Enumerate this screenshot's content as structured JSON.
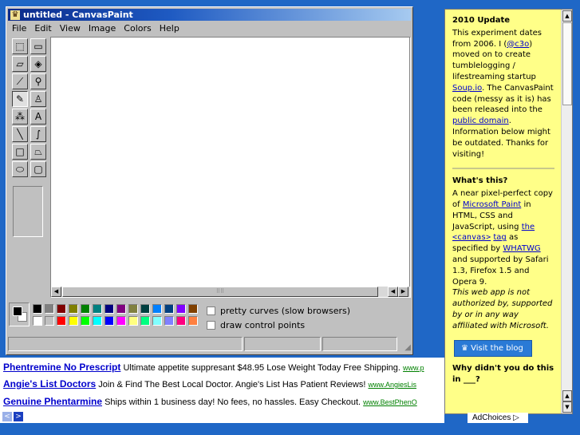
{
  "window": {
    "title": "untitled - CanvasPaint",
    "menu": [
      "File",
      "Edit",
      "View",
      "Image",
      "Colors",
      "Help"
    ]
  },
  "tools": [
    {
      "name": "free-select-icon",
      "glyph": "⬚"
    },
    {
      "name": "rect-select-icon",
      "glyph": "▭"
    },
    {
      "name": "eraser-icon",
      "glyph": "▱"
    },
    {
      "name": "fill-bucket-icon",
      "glyph": "◈"
    },
    {
      "name": "color-picker-icon",
      "glyph": "⟋"
    },
    {
      "name": "magnifier-icon",
      "glyph": "⚲"
    },
    {
      "name": "pencil-icon",
      "glyph": "✎"
    },
    {
      "name": "brush-icon",
      "glyph": "♙"
    },
    {
      "name": "airbrush-icon",
      "glyph": "⁂"
    },
    {
      "name": "text-icon",
      "glyph": "A"
    },
    {
      "name": "line-icon",
      "glyph": "╲"
    },
    {
      "name": "curve-icon",
      "glyph": "∫"
    },
    {
      "name": "rectangle-icon",
      "glyph": "□"
    },
    {
      "name": "polygon-icon",
      "glyph": "⏢"
    },
    {
      "name": "ellipse-icon",
      "glyph": "⬭"
    },
    {
      "name": "rounded-rect-icon",
      "glyph": "▢"
    }
  ],
  "palette": {
    "foreground": "#000000",
    "background": "#ffffff",
    "top_row": [
      "#000000",
      "#808080",
      "#800000",
      "#808000",
      "#008000",
      "#008080",
      "#000080",
      "#800080",
      "#808040",
      "#004040",
      "#0080ff",
      "#004080",
      "#8000ff",
      "#804000"
    ],
    "bottom_row": [
      "#ffffff",
      "#c0c0c0",
      "#ff0000",
      "#ffff00",
      "#00ff00",
      "#00ffff",
      "#0000ff",
      "#ff00ff",
      "#ffff80",
      "#00ff80",
      "#80ffff",
      "#8080ff",
      "#ff0080",
      "#ff8040"
    ]
  },
  "options": {
    "pretty_curves": "pretty curves (slow browsers)",
    "control_points": "draw control points"
  },
  "note": {
    "update_title": "2010 Update",
    "update_p1": "This experiment dates from 2006. I (",
    "handle": "@c3o",
    "update_p2": ") moved on to create tumblelogging / lifestreaming startup ",
    "soup": "Soup.io",
    "update_p3": ". The CanvasPaint code (messy as it is) has been released into the ",
    "public_domain": "public domain",
    "update_p4": ". Information below might be outdated. Thanks for visiting!",
    "what_title": "What's this?",
    "what_p1": "A near pixel-perfect copy of ",
    "ms_paint": "Microsoft Paint",
    "what_p2": " in HTML, CSS and JavaScript, using ",
    "the": "the",
    "canvas_tag": "<canvas>",
    "tag": "tag",
    "what_p3": " as specified by ",
    "whatwg": "WHATWG",
    "what_p4": " and supported by Safari 1.3, Firefox 1.5 and Opera 9.",
    "disclaimer": "This web app is not authorized by, supported by or in any way affiliated with Microsoft.",
    "blog_button": "Visit the blog",
    "why_title": "Why didn't you do this in ___?"
  },
  "ads": [
    {
      "title": "Phentremine No Prescript",
      "desc": "Ultimate appetite suppresant $48.95 Lose Weight Today Free Shipping.",
      "url": "www.p"
    },
    {
      "title": "Angie's List Doctors",
      "desc": "Join & Find The Best Local Doctor. Angie's List Has Patient Reviews!",
      "url": "www.AngiesLis"
    },
    {
      "title": "Genuine Phentarmine",
      "desc": "Ships within 1 business day! No fees, no hassles. Easy Checkout.",
      "url": "www.BestPhenO"
    }
  ],
  "adchoices": "AdChoices ▷",
  "ad_nav": {
    "prev": "<",
    "next": ">"
  }
}
